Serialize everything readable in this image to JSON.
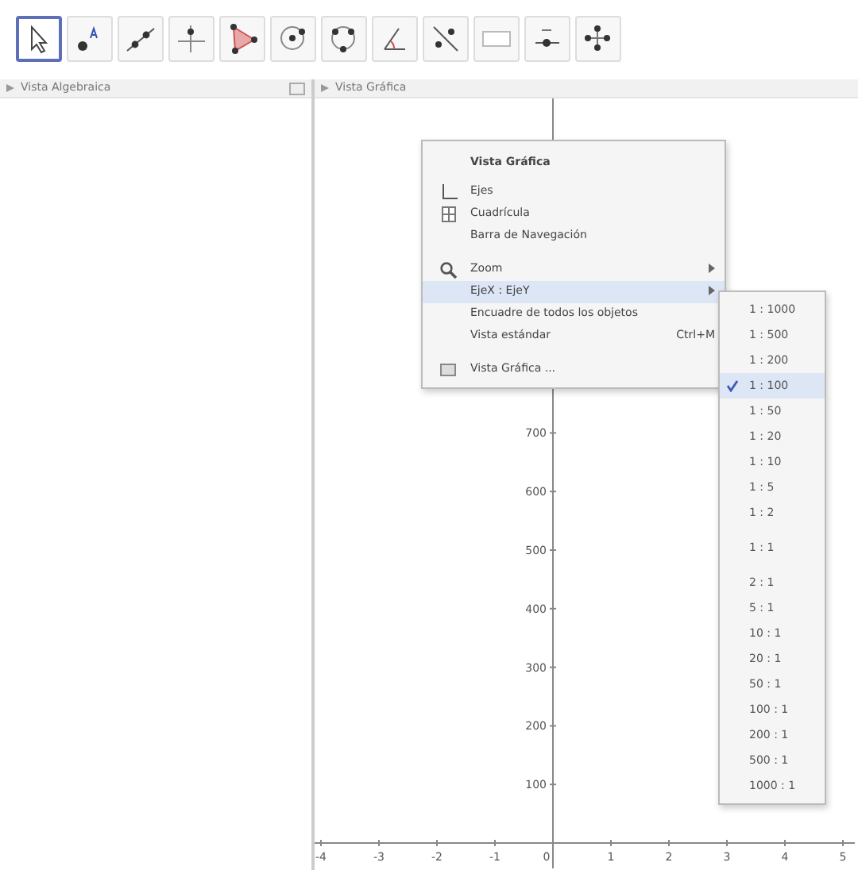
{
  "toolbar": {
    "tools": [
      {
        "selected": true
      },
      {
        "selected": false
      },
      {
        "selected": false
      },
      {
        "selected": false
      },
      {
        "selected": false
      },
      {
        "selected": false
      },
      {
        "selected": false
      },
      {
        "selected": false
      },
      {
        "selected": false
      },
      {
        "selected": false
      },
      {
        "selected": false
      },
      {
        "selected": false
      }
    ]
  },
  "algebra_view": {
    "title": "Vista Algebraica"
  },
  "graphics_view": {
    "title": "Vista Gráfica",
    "x_labels": [
      "-4",
      "-3",
      "-2",
      "-1",
      "0",
      "1",
      "2",
      "3",
      "4",
      "5"
    ],
    "y_labels": [
      "700",
      "600",
      "500",
      "400",
      "300",
      "200",
      "100"
    ]
  },
  "context_menu": {
    "title": "Vista Gráfica",
    "items": [
      {
        "kind": "item",
        "label": "Ejes",
        "highlighted": false
      },
      {
        "kind": "item",
        "label": "Cuadrícula",
        "highlighted": false
      },
      {
        "kind": "item",
        "label": "Barra de Navegación",
        "highlighted": false
      },
      {
        "kind": "separator"
      },
      {
        "kind": "submenu",
        "label": "Zoom",
        "highlighted": false
      },
      {
        "kind": "submenu",
        "label": "EjeX : EjeY",
        "highlighted": true
      },
      {
        "kind": "item",
        "label": "Encuadre de todos los objetos",
        "highlighted": false
      },
      {
        "kind": "item",
        "label": "Vista estándar",
        "shortcut": "Ctrl+M",
        "highlighted": false
      },
      {
        "kind": "separator"
      },
      {
        "kind": "item",
        "label": "Vista Gráfica ...",
        "highlighted": false
      }
    ]
  },
  "ratio_submenu": {
    "items": [
      {
        "label": "1 : 1000",
        "checked": false
      },
      {
        "label": "1 : 500",
        "checked": false
      },
      {
        "label": "1 : 200",
        "checked": false
      },
      {
        "label": "1 : 100",
        "checked": true
      },
      {
        "label": "1 : 50",
        "checked": false
      },
      {
        "label": "1 : 20",
        "checked": false
      },
      {
        "label": "1 : 10",
        "checked": false
      },
      {
        "label": "1 : 5",
        "checked": false
      },
      {
        "label": "1 : 2",
        "checked": false
      },
      {
        "kind": "gap"
      },
      {
        "label": "1 : 1",
        "checked": false
      },
      {
        "kind": "gap"
      },
      {
        "label": "2 : 1",
        "checked": false
      },
      {
        "label": "5 : 1",
        "checked": false
      },
      {
        "label": "10 : 1",
        "checked": false
      },
      {
        "label": "20 : 1",
        "checked": false
      },
      {
        "label": "50 : 1",
        "checked": false
      },
      {
        "label": "100 : 1",
        "checked": false
      },
      {
        "label": "200 : 1",
        "checked": false
      },
      {
        "label": "500 : 1",
        "checked": false
      },
      {
        "label": "1000 : 1",
        "checked": false
      }
    ]
  }
}
